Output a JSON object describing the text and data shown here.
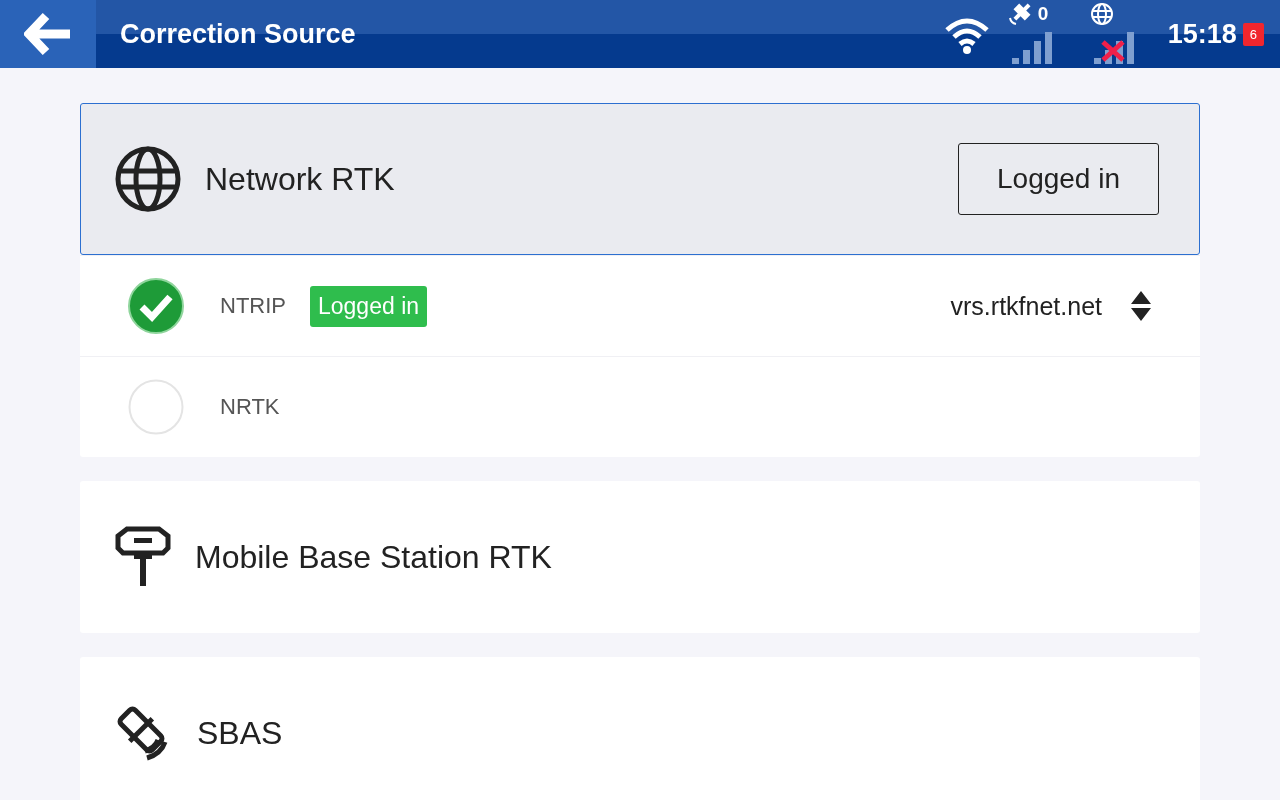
{
  "header": {
    "title": "Correction Source",
    "satellite_count": "0",
    "time": "15:18",
    "notification_count": "6"
  },
  "sources": [
    {
      "kind": "network",
      "label": "Network RTK",
      "selected": true,
      "button": "Logged in",
      "options": [
        {
          "label": "NTRIP",
          "selected": true,
          "badge": "Logged in",
          "server": "vrs.rtkfnet.net"
        },
        {
          "label": "NRTK",
          "selected": false
        }
      ]
    },
    {
      "kind": "base",
      "label": "Mobile Base Station RTK",
      "selected": false
    },
    {
      "kind": "sbas",
      "label": "SBAS",
      "selected": false
    }
  ]
}
